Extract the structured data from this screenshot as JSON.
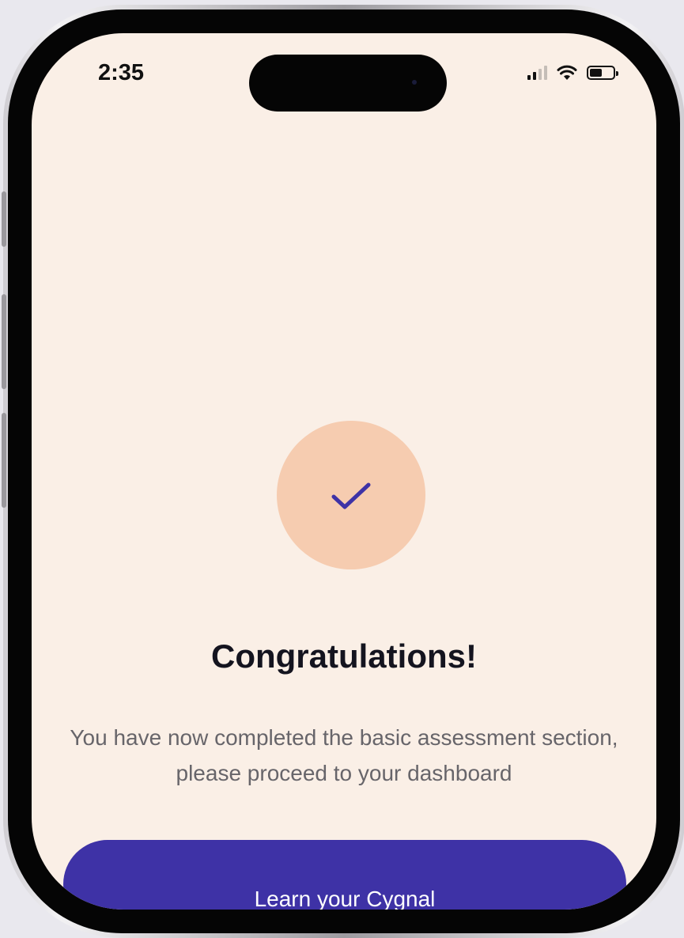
{
  "status_bar": {
    "time": "2:35",
    "icons": [
      "cellular-signal-icon",
      "wifi-icon",
      "battery-icon"
    ]
  },
  "completion": {
    "icon": "checkmark-icon",
    "title": "Congratulations!",
    "message": "You have now completed the basic assessment section, please proceed to your dashboard",
    "button_label": "Learn your Cygnal"
  },
  "colors": {
    "screen_background": "#faefe6",
    "check_circle": "#f6ccb0",
    "checkmark": "#3e32a6",
    "primary_button": "#3e32a6",
    "title_text": "#14141f",
    "body_text": "#67656a"
  }
}
